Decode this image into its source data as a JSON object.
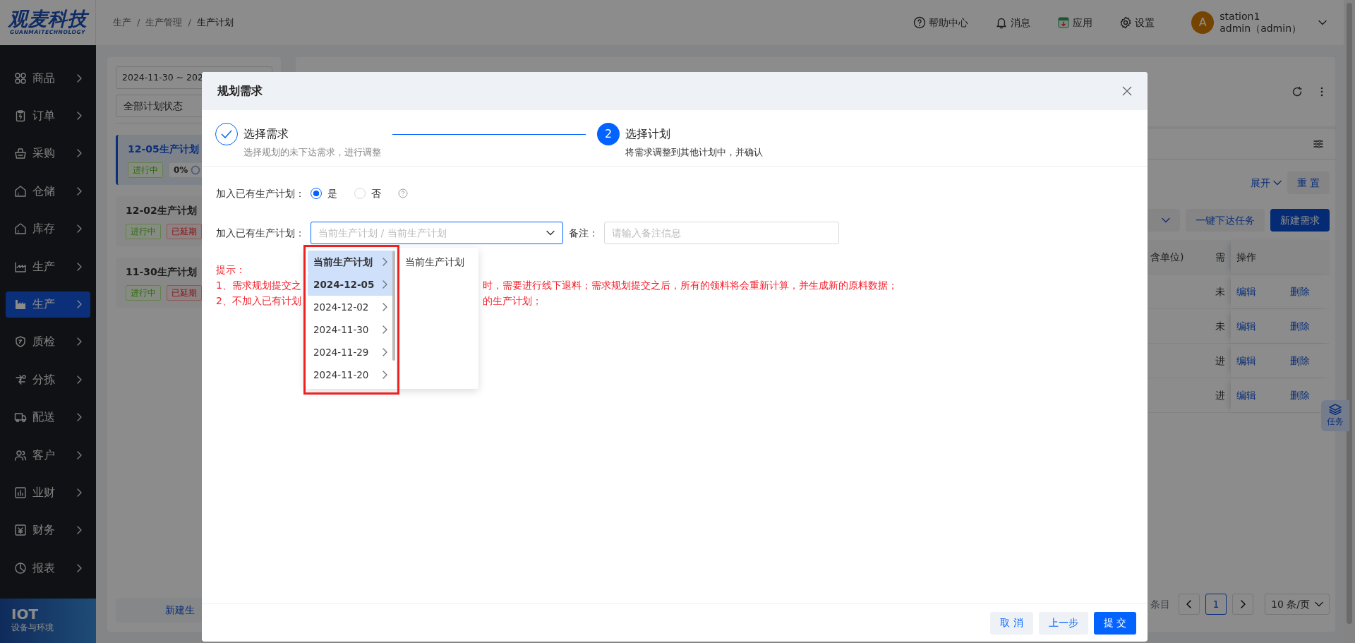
{
  "header": {
    "logo": {
      "title": "观麦科技",
      "subtitle": "GUANMAITECHNOLOGY"
    },
    "breadcrumb": [
      "生产",
      "生产管理",
      "生产计划"
    ],
    "breadcrumb_separator": "/",
    "actions": [
      "帮助中心",
      "消息",
      "应用",
      "设置"
    ],
    "user": {
      "avatar": "A",
      "name": "station1",
      "role": "admin（admin）"
    }
  },
  "sidebar": {
    "items": [
      {
        "label": "商品",
        "selected": false
      },
      {
        "label": "订单",
        "selected": false
      },
      {
        "label": "采购",
        "selected": false
      },
      {
        "label": "仓储",
        "selected": false
      },
      {
        "label": "库存",
        "selected": false
      },
      {
        "label": "生产",
        "selected": false
      },
      {
        "label": "生产",
        "selected": true
      },
      {
        "label": "质检",
        "selected": false
      },
      {
        "label": "分拣",
        "selected": false
      },
      {
        "label": "配送",
        "selected": false
      },
      {
        "label": "客户",
        "selected": false
      },
      {
        "label": "业财",
        "selected": false
      },
      {
        "label": "财务",
        "selected": false
      },
      {
        "label": "报表",
        "selected": false
      }
    ],
    "footer": {
      "title": "IOT",
      "subtitle": "设备与环境"
    }
  },
  "plan_panel": {
    "date_range": "2024-11-30 ~ 202",
    "status_filter": "全部计划状态",
    "plans": [
      {
        "title": "12-05生产计划",
        "selected": true,
        "tags": [
          {
            "kind": "running",
            "text": "进行中"
          },
          {
            "kind": "percent",
            "text": "0%"
          }
        ]
      },
      {
        "title": "12-02生产计划",
        "selected": false,
        "tags": [
          {
            "kind": "running",
            "text": "进行中"
          },
          {
            "kind": "delayed",
            "text": "已延期"
          }
        ]
      },
      {
        "title": "11-30生产计划",
        "selected": false,
        "tags": [
          {
            "kind": "running",
            "text": "进行中"
          },
          {
            "kind": "delayed",
            "text": "已延期"
          }
        ]
      }
    ],
    "new_button": "新建生"
  },
  "main_panel": {
    "expand_link": "展开",
    "reset_button": "重 置",
    "batch_button": "一键下达任务",
    "new_button": "新建需求",
    "table": {
      "columns": [
        "含单位)",
        "需",
        "操作"
      ],
      "rows": [
        {
          "status": "未",
          "actions": [
            "编辑",
            "删除"
          ]
        },
        {
          "status": "未",
          "actions": [
            "编辑",
            "删除"
          ]
        },
        {
          "status": "进",
          "actions": [
            "编辑",
            "删除"
          ]
        },
        {
          "status": "进",
          "actions": [
            "编辑",
            "删除"
          ]
        }
      ]
    },
    "pagination": {
      "total": "条目",
      "current": "1",
      "page_size": "10 条/页"
    },
    "task_button": "任务"
  },
  "modal": {
    "title": "规划需求",
    "steps": [
      {
        "finished": true,
        "title": "选择需求",
        "description": "选择规划的未下达需求，进行调整"
      },
      {
        "finished": false,
        "number": "2",
        "title": "选择计划",
        "description": "将需求调整到其他计划中，并确认"
      }
    ],
    "join_field": {
      "label": "加入已有生产计划：",
      "options": [
        {
          "label": "是",
          "selected": true
        },
        {
          "label": "否",
          "selected": false
        }
      ]
    },
    "plan_field": {
      "label": "加入已有生产计划：",
      "placeholder": "当前生产计划 / 当前生产计划"
    },
    "remark_field": {
      "label": "备注：",
      "placeholder": "请输入备注信息"
    },
    "hint": {
      "title": "提示：",
      "lines": [
        {
          "start": "1、需求规划提交之",
          "end": "时，需要进行线下退料；需求规划提交之后，所有的领料将会重新计算，并生成新的原料数据；"
        },
        {
          "start": "2、不加入已有计划",
          "end": "的生产计划；"
        }
      ]
    },
    "cascader": {
      "columns": [
        [
          {
            "label": "当前生产计划",
            "selected": true
          },
          {
            "label": "2024-12-05",
            "selected": true
          },
          {
            "label": "2024-12-02",
            "selected": false
          },
          {
            "label": "2024-11-30",
            "selected": false
          },
          {
            "label": "2024-11-29",
            "selected": false
          },
          {
            "label": "2024-11-20",
            "selected": false
          }
        ],
        [
          {
            "label": "当前生产计划",
            "selected": false
          }
        ]
      ]
    },
    "buttons": [
      {
        "kind": "default",
        "label": "取 消"
      },
      {
        "kind": "default",
        "label": "上一步"
      },
      {
        "kind": "primary",
        "label": "提 交"
      }
    ]
  }
}
